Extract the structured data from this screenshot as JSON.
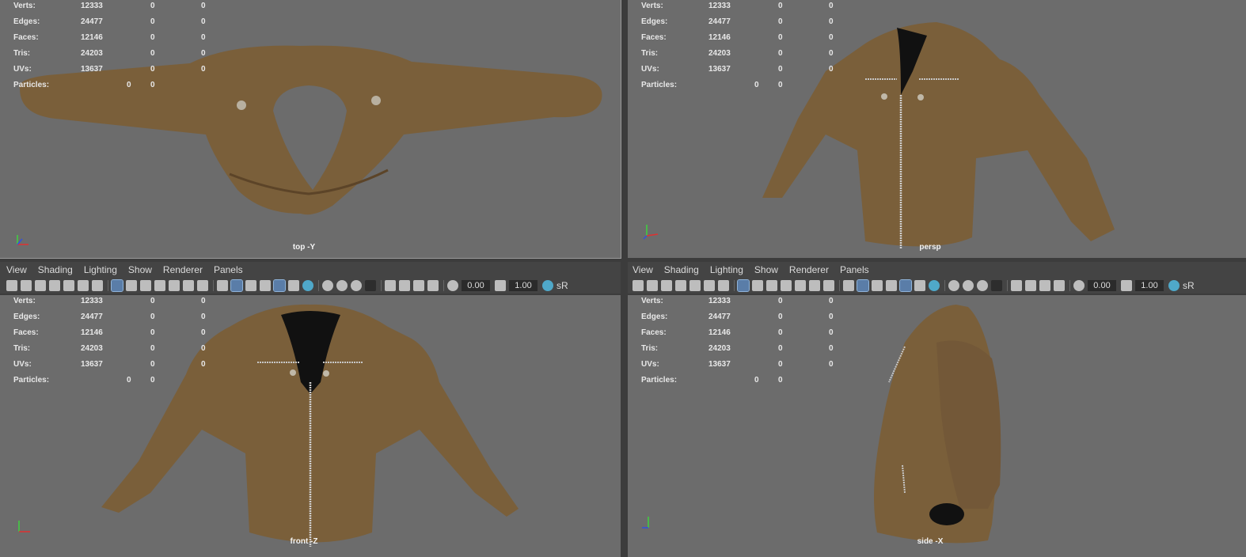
{
  "menu": {
    "left": [
      "View",
      "Shading",
      "Lighting",
      "Show",
      "Renderer",
      "Panels"
    ],
    "right": [
      "View",
      "Shading",
      "Lighting",
      "Show",
      "Renderer",
      "Panels"
    ]
  },
  "toolbar": {
    "exposure": "0.00",
    "gamma": "1.00",
    "color_mgmt_label": "sR"
  },
  "hud": {
    "labels": [
      "Verts:",
      "Edges:",
      "Faces:",
      "Tris:",
      "UVs:",
      "Particles:"
    ],
    "rows": [
      {
        "label": "Verts:",
        "a": "12333",
        "b": "0",
        "c": "0"
      },
      {
        "label": "Edges:",
        "a": "24477",
        "b": "0",
        "c": "0"
      },
      {
        "label": "Faces:",
        "a": "12146",
        "b": "0",
        "c": "0"
      },
      {
        "label": "Tris:",
        "a": "24203",
        "b": "0",
        "c": "0"
      },
      {
        "label": "UVs:",
        "a": "13637",
        "b": "0",
        "c": "0"
      }
    ],
    "particles": {
      "label": "Particles:",
      "a": "0",
      "b": "0"
    }
  },
  "viewports": {
    "top": {
      "camera": "top -Y"
    },
    "persp": {
      "camera": "persp"
    },
    "front": {
      "camera": "front -Z"
    },
    "side": {
      "camera": "side -X"
    }
  },
  "colors": {
    "viewport_bg": "#6c6c6c",
    "jacket": "#7a5f3a",
    "accent": "#4fa8c9"
  }
}
